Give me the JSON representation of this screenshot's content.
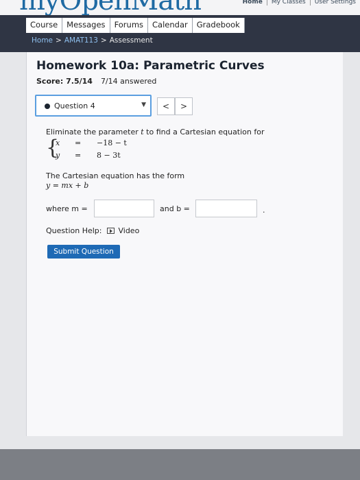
{
  "header": {
    "brand": "myOpenMath",
    "top_links": [
      "Home",
      "My Classes",
      "User Settings"
    ]
  },
  "nav": {
    "tabs": [
      "Course",
      "Messages",
      "Forums",
      "Calendar",
      "Gradebook"
    ]
  },
  "breadcrumb": {
    "home": "Home",
    "sep1": ">",
    "course": "AMAT113",
    "sep2": ">",
    "current": "Assessment"
  },
  "assessment": {
    "title": "Homework 10a: Parametric Curves",
    "score": "Score: 7.5/14",
    "answered": "7/14 answered",
    "question_label": "Question 4",
    "prev": "<",
    "next": ">"
  },
  "question": {
    "prompt_prefix": "Eliminate the parameter",
    "param": "t",
    "prompt_suffix": "to find a Cartesian equation for",
    "x_var": "x",
    "x_eq": "=",
    "x_expr": "−18 − t",
    "y_var": "y",
    "y_eq": "=",
    "y_expr": "8 − 3t",
    "form_text": "The Cartesian equation has the form",
    "form_eq": "y = mx + b",
    "where_label": "where m =",
    "and_label": "and b =",
    "period": ".",
    "m_value": "",
    "b_value": "",
    "help_label": "Question Help:",
    "video_label": "Video",
    "submit_label": "Submit Question"
  }
}
